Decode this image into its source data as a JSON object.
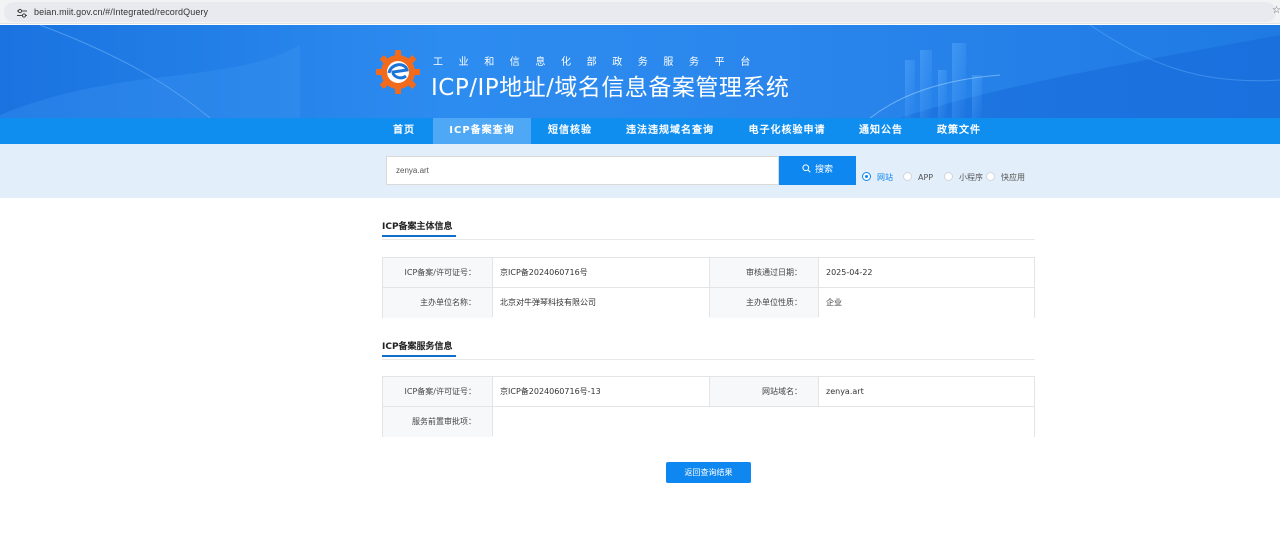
{
  "browser": {
    "url": "beian.miit.gov.cn/#/Integrated/recordQuery"
  },
  "header": {
    "subtitle": "工业和信息化部政务服务平台",
    "title": "ICP/IP地址/域名信息备案管理系统"
  },
  "nav": {
    "items": [
      {
        "label": "首页"
      },
      {
        "label": "ICP备案查询"
      },
      {
        "label": "短信核验"
      },
      {
        "label": "违法违规域名查询"
      },
      {
        "label": "电子化核验申请"
      },
      {
        "label": "通知公告"
      },
      {
        "label": "政策文件"
      }
    ],
    "active_index": 1
  },
  "search": {
    "value": "zenya.art",
    "button_label": "搜索",
    "options": [
      {
        "label": "网站",
        "checked": true
      },
      {
        "label": "APP",
        "checked": false
      },
      {
        "label": "小程序",
        "checked": false
      },
      {
        "label": "快应用",
        "checked": false
      }
    ]
  },
  "entity_section": {
    "title": "ICP备案主体信息",
    "rows": [
      {
        "label1": "ICP备案/许可证号：",
        "value1": "京ICP备2024060716号",
        "label2": "审核通过日期：",
        "value2": "2025-04-22"
      },
      {
        "label1": "主办单位名称：",
        "value1": "北京对牛弹琴科技有限公司",
        "label2": "主办单位性质：",
        "value2": "企业"
      }
    ]
  },
  "service_section": {
    "title": "ICP备案服务信息",
    "row1": {
      "label1": "ICP备案/许可证号：",
      "value1": "京ICP备2024060716号-13",
      "label2": "网站域名：",
      "value2": "zenya.art"
    },
    "row2": {
      "label": "服务前置审批项：",
      "value": ""
    }
  },
  "actions": {
    "back_label": "返回查询结果"
  },
  "colors": {
    "primary": "#0e87f0",
    "nav": "#0f8ef0",
    "nav_active": "#4ea8f5",
    "logo_orange": "#f26b1d"
  }
}
